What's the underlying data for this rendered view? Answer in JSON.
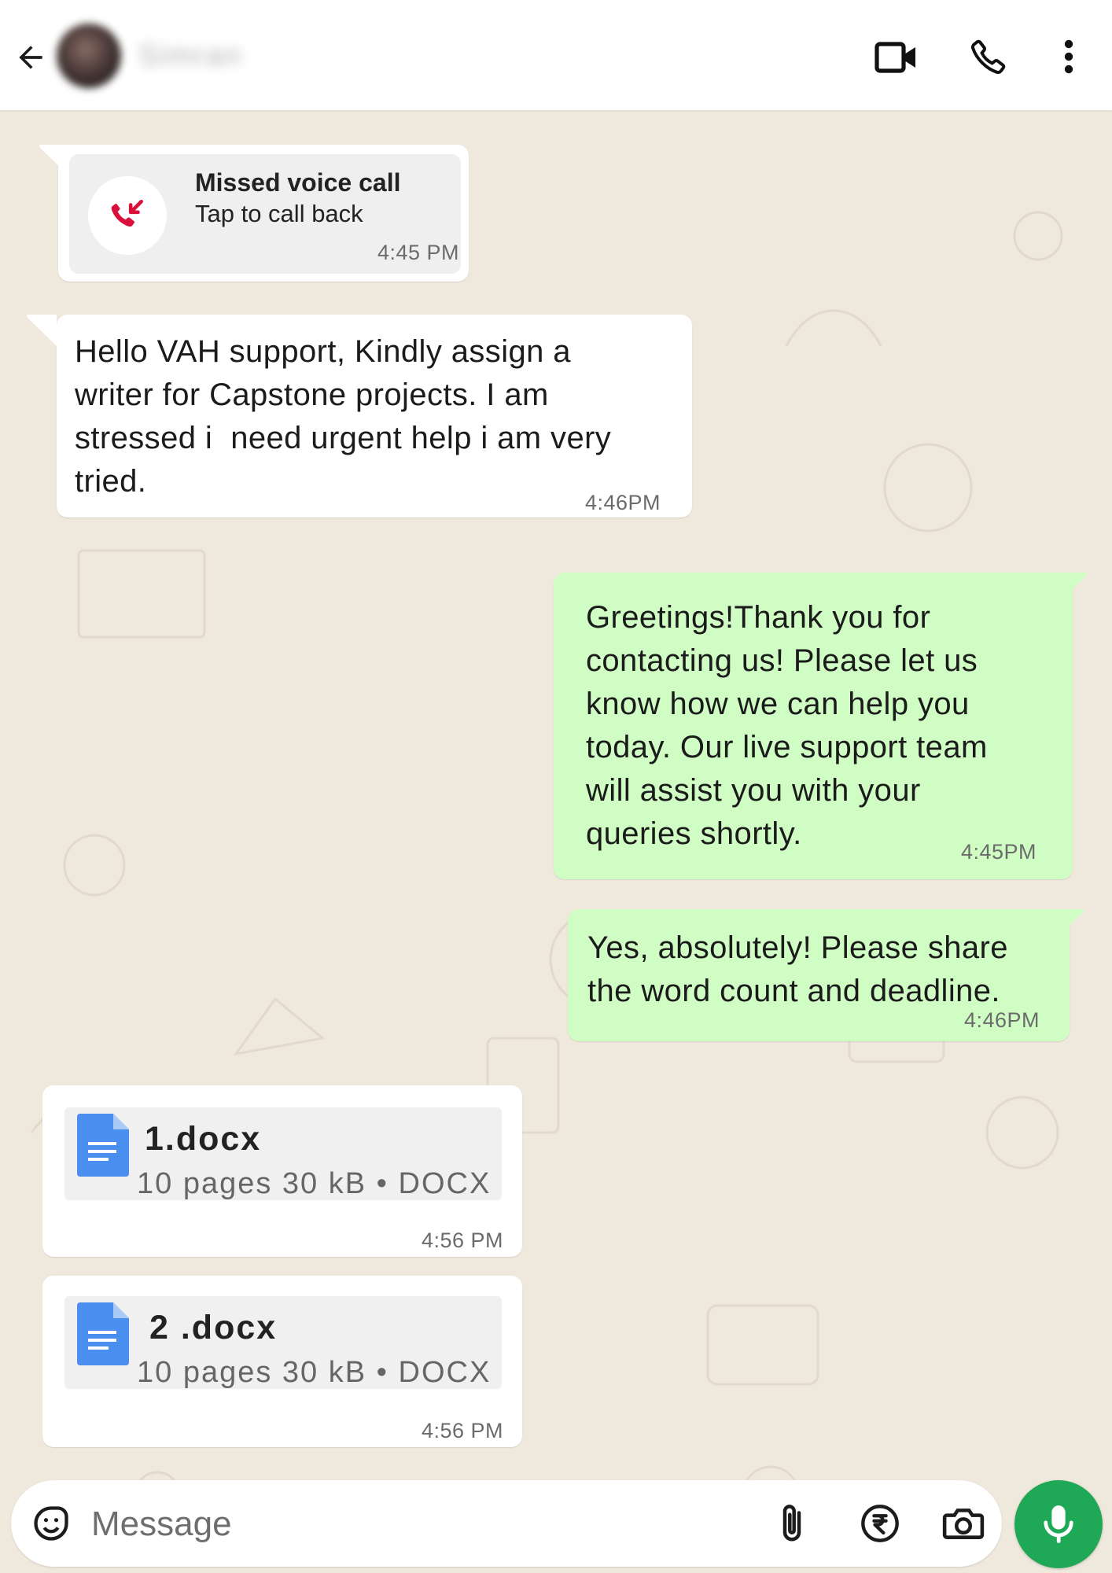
{
  "header": {
    "contact_name": "Simran",
    "back_icon": "back-arrow-icon",
    "video_icon": "video-camera-icon",
    "call_icon": "phone-icon",
    "menu_icon": "more-vertical-icon"
  },
  "messages": [
    {
      "type": "missed-call",
      "direction": "incoming",
      "title": "Missed voice call",
      "subtitle": "Tap to call back",
      "time": "4:45 PM",
      "icon": "missed-call-icon",
      "icon_color": "#d9103a"
    },
    {
      "type": "text",
      "direction": "incoming",
      "lines": [
        "Hello VAH support, Kindly assign a",
        "writer for Capstone projects. I am",
        "stressed i  need urgent help i am very",
        "tried."
      ],
      "time": "4:46PM"
    },
    {
      "type": "text",
      "direction": "outgoing",
      "lines": [
        "Greetings!Thank you for",
        "contacting us! Please let us",
        "know how we can help you",
        "today. Our live support team",
        "will assist you with your",
        "queries shortly."
      ],
      "time": "4:45PM"
    },
    {
      "type": "text",
      "direction": "outgoing",
      "lines": [
        "Yes, absolutely! Please share",
        "the word count and deadline."
      ],
      "time": "4:46PM"
    },
    {
      "type": "document",
      "direction": "incoming",
      "name": "1.docx",
      "meta": "10 pages 30 kB • DOCX",
      "time": "4:56 PM",
      "icon": "document-icon"
    },
    {
      "type": "document",
      "direction": "incoming",
      "name": "2 .docx",
      "meta": "10 pages 30 kB • DOCX",
      "time": "4:56 PM",
      "icon": "document-icon"
    }
  ],
  "composer": {
    "placeholder": "Message",
    "emoji_icon": "sticker-emoji-icon",
    "attach_icon": "paperclip-icon",
    "payment_icon": "rupee-icon",
    "camera_icon": "camera-icon",
    "mic_icon": "microphone-icon"
  },
  "colors": {
    "outgoing_bubble": "#d0fdc4",
    "incoming_bubble": "#ffffff",
    "wallpaper": "#efe8dd",
    "mic_button": "#1fa855",
    "missed_call": "#d9103a"
  }
}
